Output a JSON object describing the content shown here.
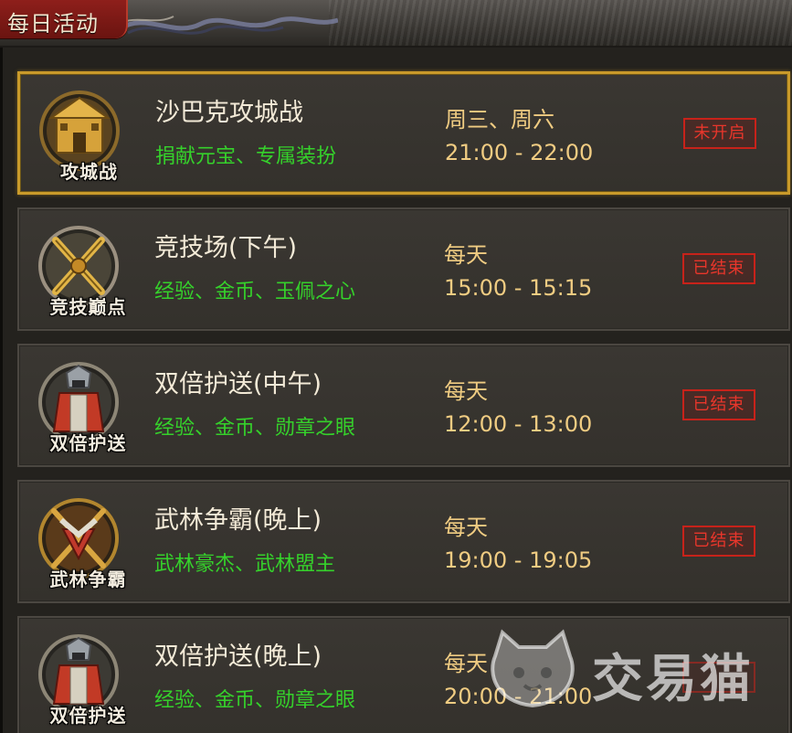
{
  "header": {
    "title": "每日活动"
  },
  "activities": [
    {
      "name": "沙巴克攻城战",
      "rewards": "捐献元宝、专属装扮",
      "days": "周三、周六",
      "time": "21:00 - 22:00",
      "status": "未开启",
      "emblem_label": "攻城战",
      "emblem_icon": "castle-icon"
    },
    {
      "name": "竞技场(下午)",
      "rewards": "经验、金币、玉佩之心",
      "days": "每天",
      "time": "15:00 - 15:15",
      "status": "已结束",
      "emblem_label": "竞技巅点",
      "emblem_icon": "crossed-swords-icon"
    },
    {
      "name": "双倍护送(中午)",
      "rewards": "经验、金币、勋章之眼",
      "days": "每天",
      "time": "12:00 - 13:00",
      "status": "已结束",
      "emblem_label": "双倍护送",
      "emblem_icon": "warrior-escort-icon"
    },
    {
      "name": "武林争霸(晚上)",
      "rewards": "武林豪杰、武林盟主",
      "days": "每天",
      "time": "19:00 - 19:05",
      "status": "已结束",
      "emblem_label": "武林争霸",
      "emblem_icon": "wulin-crest-icon"
    },
    {
      "name": "双倍护送(晚上)",
      "rewards": "经验、金币、勋章之眼",
      "days": "每天",
      "time": "20:00 - 21:00",
      "status": "",
      "emblem_label": "双倍护送",
      "emblem_icon": "warrior-escort-icon"
    }
  ],
  "watermark": {
    "text": "交易猫",
    "icon": "cat-logo-icon"
  },
  "colors": {
    "title_tab": "#8e1f1b",
    "selected_border": "#c99a2a",
    "reward_green": "#35d12b",
    "time_gold": "#f0cc82",
    "status_red": "#e8362b"
  }
}
